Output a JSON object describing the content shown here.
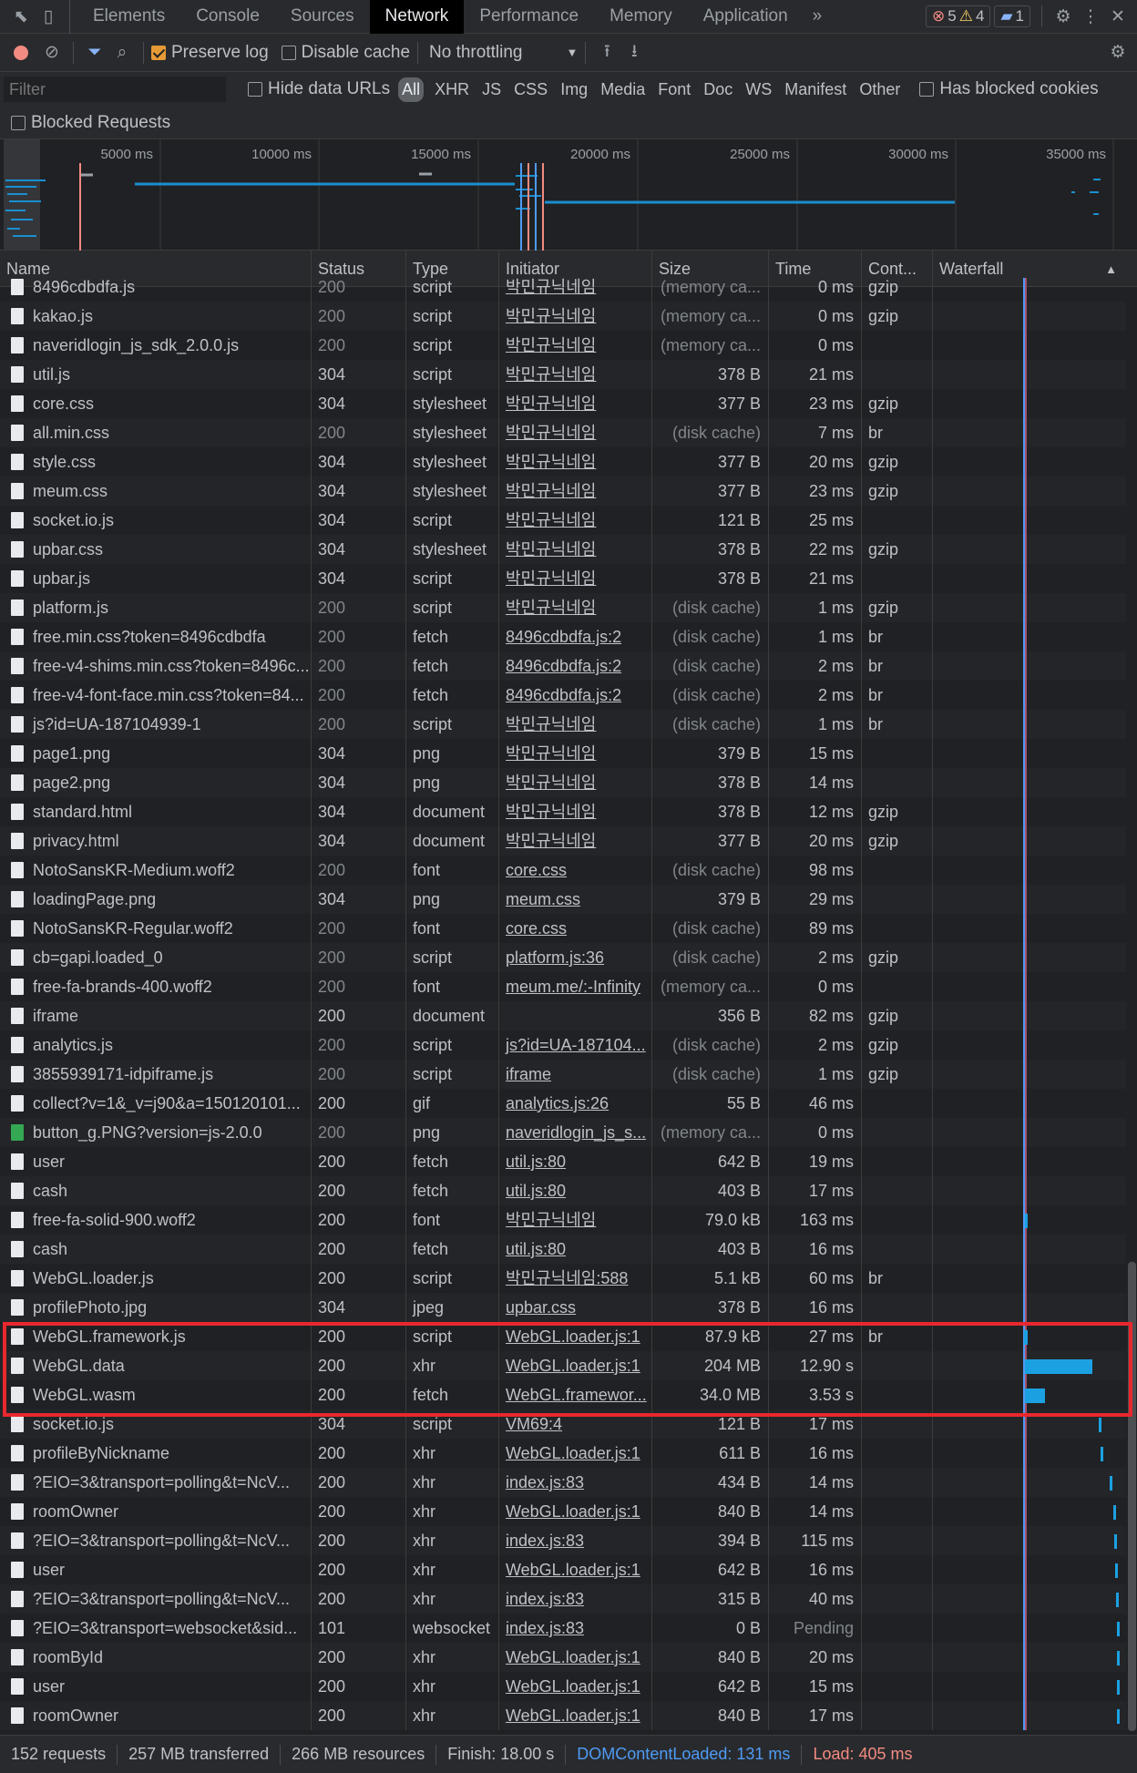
{
  "tabs": [
    "Elements",
    "Console",
    "Sources",
    "Network",
    "Performance",
    "Memory",
    "Application"
  ],
  "active_tab": "Network",
  "more_tabs": "»",
  "badges": {
    "errors": "5",
    "warnings": "4",
    "messages": "1"
  },
  "toolbar": {
    "preserve_log": "Preserve log",
    "disable_cache": "Disable cache",
    "throttling": "No throttling"
  },
  "filter": {
    "placeholder": "Filter",
    "hide_data_urls": "Hide data URLs",
    "types": [
      "All",
      "XHR",
      "JS",
      "CSS",
      "Img",
      "Media",
      "Font",
      "Doc",
      "WS",
      "Manifest",
      "Other"
    ],
    "has_blocked_cookies": "Has blocked cookies",
    "blocked_requests": "Blocked Requests"
  },
  "overview_ticks": [
    "5000 ms",
    "10000 ms",
    "15000 ms",
    "20000 ms",
    "25000 ms",
    "30000 ms",
    "35000 ms"
  ],
  "columns": [
    "Name",
    "Status",
    "Type",
    "Initiator",
    "Size",
    "Time",
    "Cont...",
    "Waterfall"
  ],
  "rows": [
    [
      "8496cdbdfa.js",
      "200",
      "script",
      "박민규닉네임",
      "(memory ca...",
      "0 ms",
      "gzip"
    ],
    [
      "kakao.js",
      "200",
      "script",
      "박민규닉네임",
      "(memory ca...",
      "0 ms",
      "gzip"
    ],
    [
      "naveridlogin_js_sdk_2.0.0.js",
      "200",
      "script",
      "박민규닉네임",
      "(memory ca...",
      "0 ms",
      ""
    ],
    [
      "util.js",
      "304",
      "script",
      "박민규닉네임",
      "378 B",
      "21 ms",
      ""
    ],
    [
      "core.css",
      "304",
      "stylesheet",
      "박민규닉네임",
      "377 B",
      "23 ms",
      "gzip"
    ],
    [
      "all.min.css",
      "200",
      "stylesheet",
      "박민규닉네임",
      "(disk cache)",
      "7 ms",
      "br"
    ],
    [
      "style.css",
      "304",
      "stylesheet",
      "박민규닉네임",
      "377 B",
      "20 ms",
      "gzip"
    ],
    [
      "meum.css",
      "304",
      "stylesheet",
      "박민규닉네임",
      "377 B",
      "23 ms",
      "gzip"
    ],
    [
      "socket.io.js",
      "304",
      "script",
      "박민규닉네임",
      "121 B",
      "25 ms",
      ""
    ],
    [
      "upbar.css",
      "304",
      "stylesheet",
      "박민규닉네임",
      "378 B",
      "22 ms",
      "gzip"
    ],
    [
      "upbar.js",
      "304",
      "script",
      "박민규닉네임",
      "378 B",
      "21 ms",
      ""
    ],
    [
      "platform.js",
      "200",
      "script",
      "박민규닉네임",
      "(disk cache)",
      "1 ms",
      "gzip"
    ],
    [
      "free.min.css?token=8496cdbdfa",
      "200",
      "fetch",
      "8496cdbdfa.js:2",
      "(disk cache)",
      "1 ms",
      "br"
    ],
    [
      "free-v4-shims.min.css?token=8496c...",
      "200",
      "fetch",
      "8496cdbdfa.js:2",
      "(disk cache)",
      "2 ms",
      "br"
    ],
    [
      "free-v4-font-face.min.css?token=84...",
      "200",
      "fetch",
      "8496cdbdfa.js:2",
      "(disk cache)",
      "2 ms",
      "br"
    ],
    [
      "js?id=UA-187104939-1",
      "200",
      "script",
      "박민규닉네임",
      "(disk cache)",
      "1 ms",
      "br"
    ],
    [
      "page1.png",
      "304",
      "png",
      "박민규닉네임",
      "379 B",
      "15 ms",
      ""
    ],
    [
      "page2.png",
      "304",
      "png",
      "박민규닉네임",
      "378 B",
      "14 ms",
      ""
    ],
    [
      "standard.html",
      "304",
      "document",
      "박민규닉네임",
      "378 B",
      "12 ms",
      "gzip"
    ],
    [
      "privacy.html",
      "304",
      "document",
      "박민규닉네임",
      "377 B",
      "20 ms",
      "gzip"
    ],
    [
      "NotoSansKR-Medium.woff2",
      "200",
      "font",
      "core.css",
      "(disk cache)",
      "98 ms",
      ""
    ],
    [
      "loadingPage.png",
      "304",
      "png",
      "meum.css",
      "379 B",
      "29 ms",
      ""
    ],
    [
      "NotoSansKR-Regular.woff2",
      "200",
      "font",
      "core.css",
      "(disk cache)",
      "89 ms",
      ""
    ],
    [
      "cb=gapi.loaded_0",
      "200",
      "script",
      "platform.js:36",
      "(disk cache)",
      "2 ms",
      "gzip"
    ],
    [
      "free-fa-brands-400.woff2",
      "200",
      "font",
      "meum.me/:-Infinity",
      "(memory ca...",
      "0 ms",
      ""
    ],
    [
      "iframe",
      "200",
      "document",
      "",
      "356 B",
      "82 ms",
      "gzip"
    ],
    [
      "analytics.js",
      "200",
      "script",
      "js?id=UA-187104...",
      "(disk cache)",
      "2 ms",
      "gzip"
    ],
    [
      "3855939171-idpiframe.js",
      "200",
      "script",
      "iframe",
      "(disk cache)",
      "1 ms",
      "gzip"
    ],
    [
      "collect?v=1&_v=j90&a=150120101...",
      "200",
      "gif",
      "analytics.js:26",
      "55 B",
      "46 ms",
      ""
    ],
    [
      "button_g.PNG?version=js-2.0.0",
      "200",
      "png",
      "naveridlogin_js_s...",
      "(memory ca...",
      "0 ms",
      ""
    ],
    [
      "user",
      "200",
      "fetch",
      "util.js:80",
      "642 B",
      "19 ms",
      ""
    ],
    [
      "cash",
      "200",
      "fetch",
      "util.js:80",
      "403 B",
      "17 ms",
      ""
    ],
    [
      "free-fa-solid-900.woff2",
      "200",
      "font",
      "박민규닉네임",
      "79.0 kB",
      "163 ms",
      ""
    ],
    [
      "cash",
      "200",
      "fetch",
      "util.js:80",
      "403 B",
      "16 ms",
      ""
    ],
    [
      "WebGL.loader.js",
      "200",
      "script",
      "박민규닉네임:588",
      "5.1 kB",
      "60 ms",
      "br"
    ],
    [
      "profilePhoto.jpg",
      "304",
      "jpeg",
      "upbar.css",
      "378 B",
      "16 ms",
      ""
    ],
    [
      "WebGL.framework.js",
      "200",
      "script",
      "WebGL.loader.js:1",
      "87.9 kB",
      "27 ms",
      "br"
    ],
    [
      "WebGL.data",
      "200",
      "xhr",
      "WebGL.loader.js:1",
      "204 MB",
      "12.90 s",
      ""
    ],
    [
      "WebGL.wasm",
      "200",
      "fetch",
      "WebGL.framewor...",
      "34.0 MB",
      "3.53 s",
      ""
    ],
    [
      "socket.io.js",
      "304",
      "script",
      "VM69:4",
      "121 B",
      "17 ms",
      ""
    ],
    [
      "profileByNickname",
      "200",
      "xhr",
      "WebGL.loader.js:1",
      "611 B",
      "16 ms",
      ""
    ],
    [
      "?EIO=3&transport=polling&t=NcV...",
      "200",
      "xhr",
      "index.js:83",
      "434 B",
      "14 ms",
      ""
    ],
    [
      "roomOwner",
      "200",
      "xhr",
      "WebGL.loader.js:1",
      "840 B",
      "14 ms",
      ""
    ],
    [
      "?EIO=3&transport=polling&t=NcV...",
      "200",
      "xhr",
      "index.js:83",
      "394 B",
      "115 ms",
      ""
    ],
    [
      "user",
      "200",
      "xhr",
      "WebGL.loader.js:1",
      "642 B",
      "16 ms",
      ""
    ],
    [
      "?EIO=3&transport=polling&t=NcV...",
      "200",
      "xhr",
      "index.js:83",
      "315 B",
      "40 ms",
      ""
    ],
    [
      "?EIO=3&transport=websocket&sid...",
      "101",
      "websocket",
      "index.js:83",
      "0 B",
      "Pending",
      ""
    ],
    [
      "roomById",
      "200",
      "xhr",
      "WebGL.loader.js:1",
      "840 B",
      "20 ms",
      ""
    ],
    [
      "user",
      "200",
      "xhr",
      "WebGL.loader.js:1",
      "642 B",
      "15 ms",
      ""
    ],
    [
      "roomOwner",
      "200",
      "xhr",
      "WebGL.loader.js:1",
      "840 B",
      "17 ms",
      ""
    ]
  ],
  "status": {
    "requests": "152 requests",
    "transferred": "257 MB transferred",
    "resources": "266 MB resources",
    "finish": "Finish: 18.00 s",
    "dcl": "DOMContentLoaded: 131 ms",
    "load": "Load: 405 ms"
  },
  "colors": {
    "accent": "#8ab4f8",
    "waterfall": "#1ba1e2",
    "highlight": "#e8282e",
    "dcl": "#4e9bf5",
    "load": "#f28b82"
  }
}
